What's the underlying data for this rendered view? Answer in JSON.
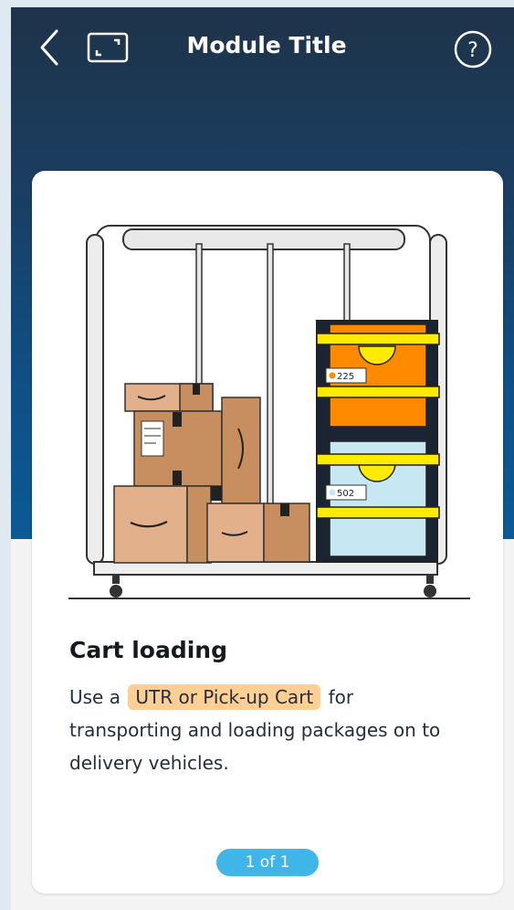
{
  "header": {
    "title": "Module Title",
    "icons": {
      "back": "chevron-left-icon",
      "expand": "expand-icon",
      "help": "help-icon"
    }
  },
  "card": {
    "heading": "Cart loading",
    "body_prefix": "Use a",
    "body_highlight": "UTR or Pick-up Cart",
    "body_suffix": "for transporting and loading packages on to delivery vehicles.",
    "tote_labels": [
      "225",
      "502"
    ],
    "pager": "1 of 1"
  },
  "colors": {
    "header_top": "#1e3349",
    "header_bottom": "#0b5a96",
    "highlight": "#ffcf93",
    "pager": "#3fb5e8",
    "tote_orange": "#ff8a00",
    "tote_blue": "#c7e7f3",
    "strap_yellow": "#ffeb00",
    "box_brown": "#c78f5f"
  }
}
